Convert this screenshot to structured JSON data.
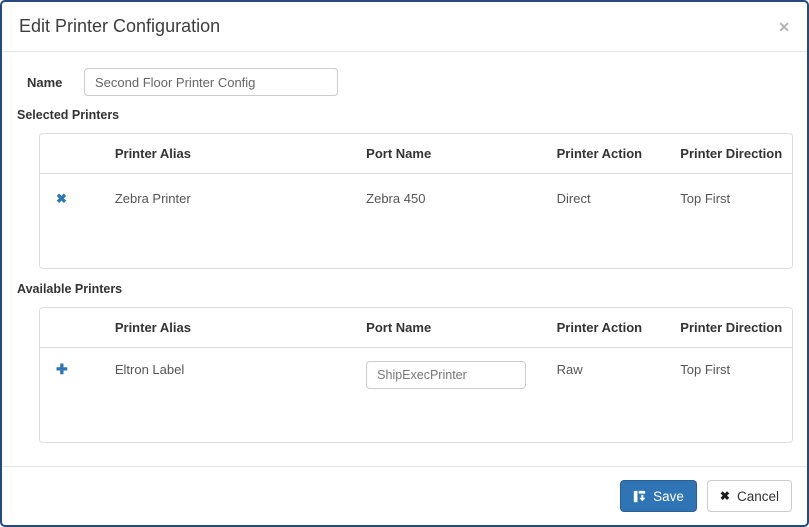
{
  "dialog": {
    "title": "Edit Printer Configuration",
    "close_glyph": "✕"
  },
  "name_field": {
    "label": "Name",
    "value": "Second Floor Printer Config"
  },
  "columns": [
    "Printer Alias",
    "Port Name",
    "Printer Action",
    "Printer Direction"
  ],
  "selected_printers": {
    "label": "Selected Printers",
    "row": {
      "remove_glyph": "✖",
      "printer_alias": "Zebra Printer",
      "port_name": "Zebra 450",
      "printer_action": "Direct",
      "printer_direction": "Top First"
    }
  },
  "available_printers": {
    "label": "Available Printers",
    "row": {
      "add_glyph": "✚",
      "printer_alias": "Eltron Label",
      "port_name_value": "ShipExecPrinter",
      "printer_action": "Raw",
      "printer_direction": "Top First"
    }
  },
  "footer": {
    "save_label": "Save",
    "cancel_glyph": "✖",
    "cancel_label": "Cancel"
  },
  "colors": {
    "accent_blue": "#2e75b6",
    "save_button_bg": "#2f75b5",
    "modal_border": "#264a7d"
  }
}
